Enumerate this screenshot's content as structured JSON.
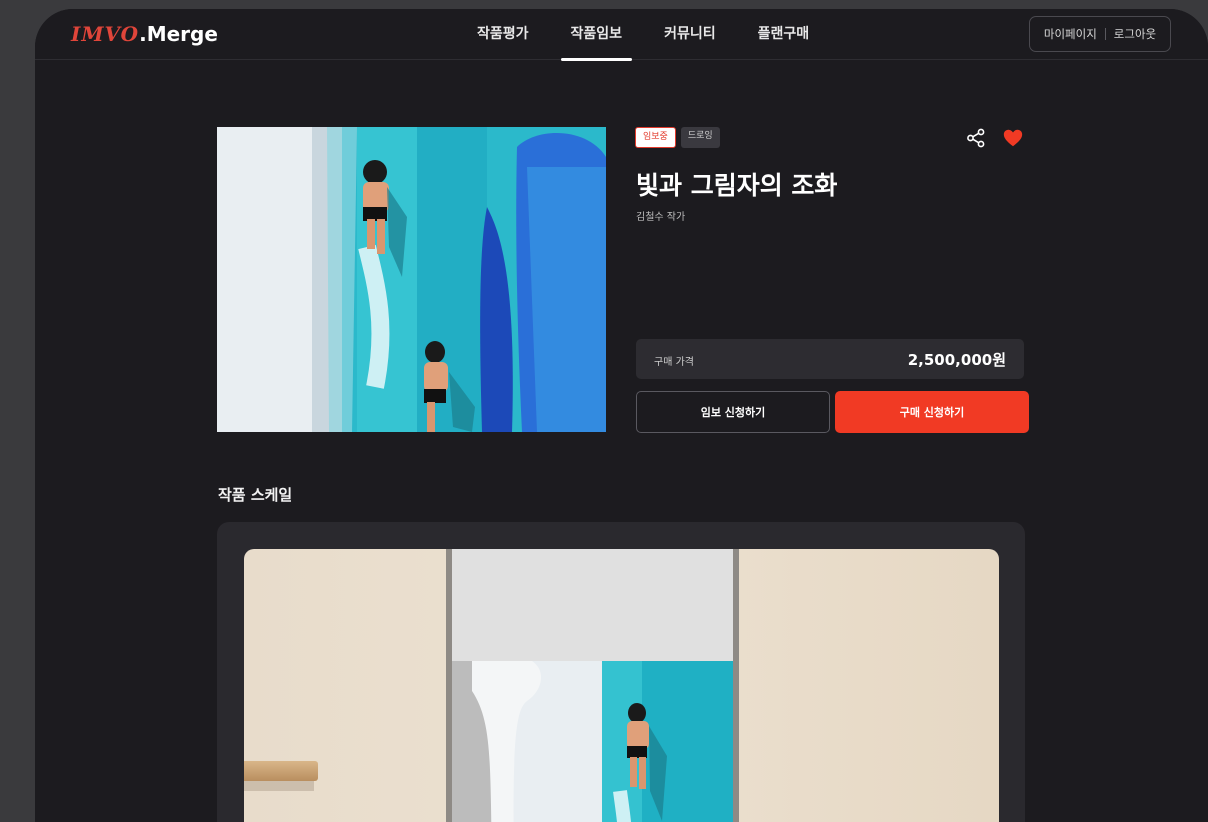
{
  "brand": {
    "logo_script": "IMVO",
    "logo_suffix": ".Merge"
  },
  "nav": {
    "items": [
      {
        "label": "작품평가",
        "active": false
      },
      {
        "label": "작품임보",
        "active": true
      },
      {
        "label": "커뮤니티",
        "active": false
      },
      {
        "label": "플랜구매",
        "active": false
      }
    ]
  },
  "account": {
    "mypage": "마이페이지",
    "logout": "로그아웃"
  },
  "artwork": {
    "badges": {
      "status": "임보중",
      "category": "드로잉"
    },
    "title": "빛과 그림자의 조화",
    "artist": "김철수 작가",
    "price_label": "구매 가격",
    "price_value": "2,500,000원",
    "liked": true
  },
  "actions": {
    "foster_label": "임보 신청하기",
    "purchase_label": "구매 신청하기"
  },
  "scale_section": {
    "title": "작품 스케일"
  },
  "icons": {
    "share": "share-icon",
    "like": "heart-icon"
  },
  "colors": {
    "accent": "#f13a24",
    "background": "#1c1b1f",
    "panel": "#2a292e"
  }
}
